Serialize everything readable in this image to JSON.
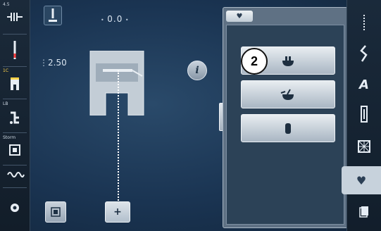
{
  "left_toolbar": {
    "top_label": "4.5",
    "tension_label": "1C",
    "feed_label": "LB",
    "presser_label": "Storm",
    "items": [
      "stitch-width-icon",
      "needle-icon",
      "presser-foot-icon",
      "feed-dog-icon",
      "stitch-plate-icon",
      "thread-tension-icon",
      "settings-icon"
    ]
  },
  "stitch_area": {
    "width_value": "0.0",
    "length_value": "2.50"
  },
  "panel": {
    "tab_icon": "heart-icon",
    "buttons": [
      {
        "icon": "hook-both-icon"
      },
      {
        "icon": "hook-left-icon"
      },
      {
        "icon": "hook-single-icon"
      }
    ]
  },
  "callout": "2",
  "right_toolbar": {
    "items": [
      "practical-stitches-icon",
      "decorative-stitches-icon",
      "alphabets-icon",
      "buttonholes-icon",
      "quilt-stitches-icon",
      "personal-program-icon",
      "memory-icon"
    ],
    "alphabet_label": "A"
  },
  "colors": {
    "accent": "#ffd34a",
    "panel": "#5f7184",
    "background": "#1a3452"
  }
}
